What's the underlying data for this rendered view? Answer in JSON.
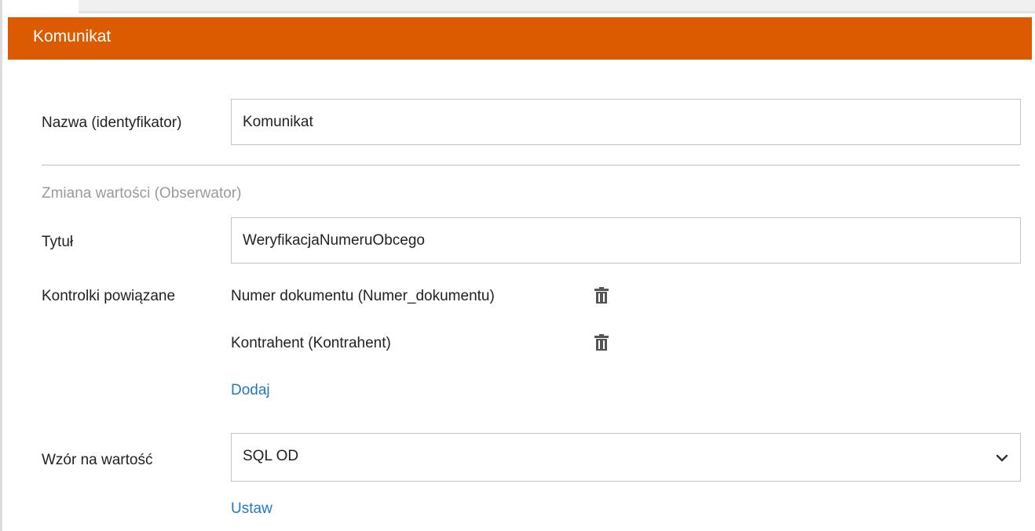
{
  "panel": {
    "title": "Komunikat"
  },
  "fields": {
    "name_label": "Nazwa (identyfikator)",
    "name_value": "Komunikat",
    "section_heading": "Zmiana wartości (Obserwator)",
    "title_label": "Tytuł",
    "title_value": "WeryfikacjaNumeruObcego",
    "linked_label": "Kontrolki powiązane",
    "linked_items": [
      {
        "label": "Numer dokumentu (Numer_dokumentu)",
        "icon": "trash-icon"
      },
      {
        "label": "Kontrahent (Kontrahent)",
        "icon": "trash-icon"
      }
    ],
    "add_link": "Dodaj",
    "formula_label": "Wzór na wartość",
    "formula_value": "SQL OD",
    "set_link": "Ustaw"
  },
  "colors": {
    "header_bg": "#dd5b00",
    "link": "#1f7ac2",
    "muted_text": "#9a9a9a"
  }
}
